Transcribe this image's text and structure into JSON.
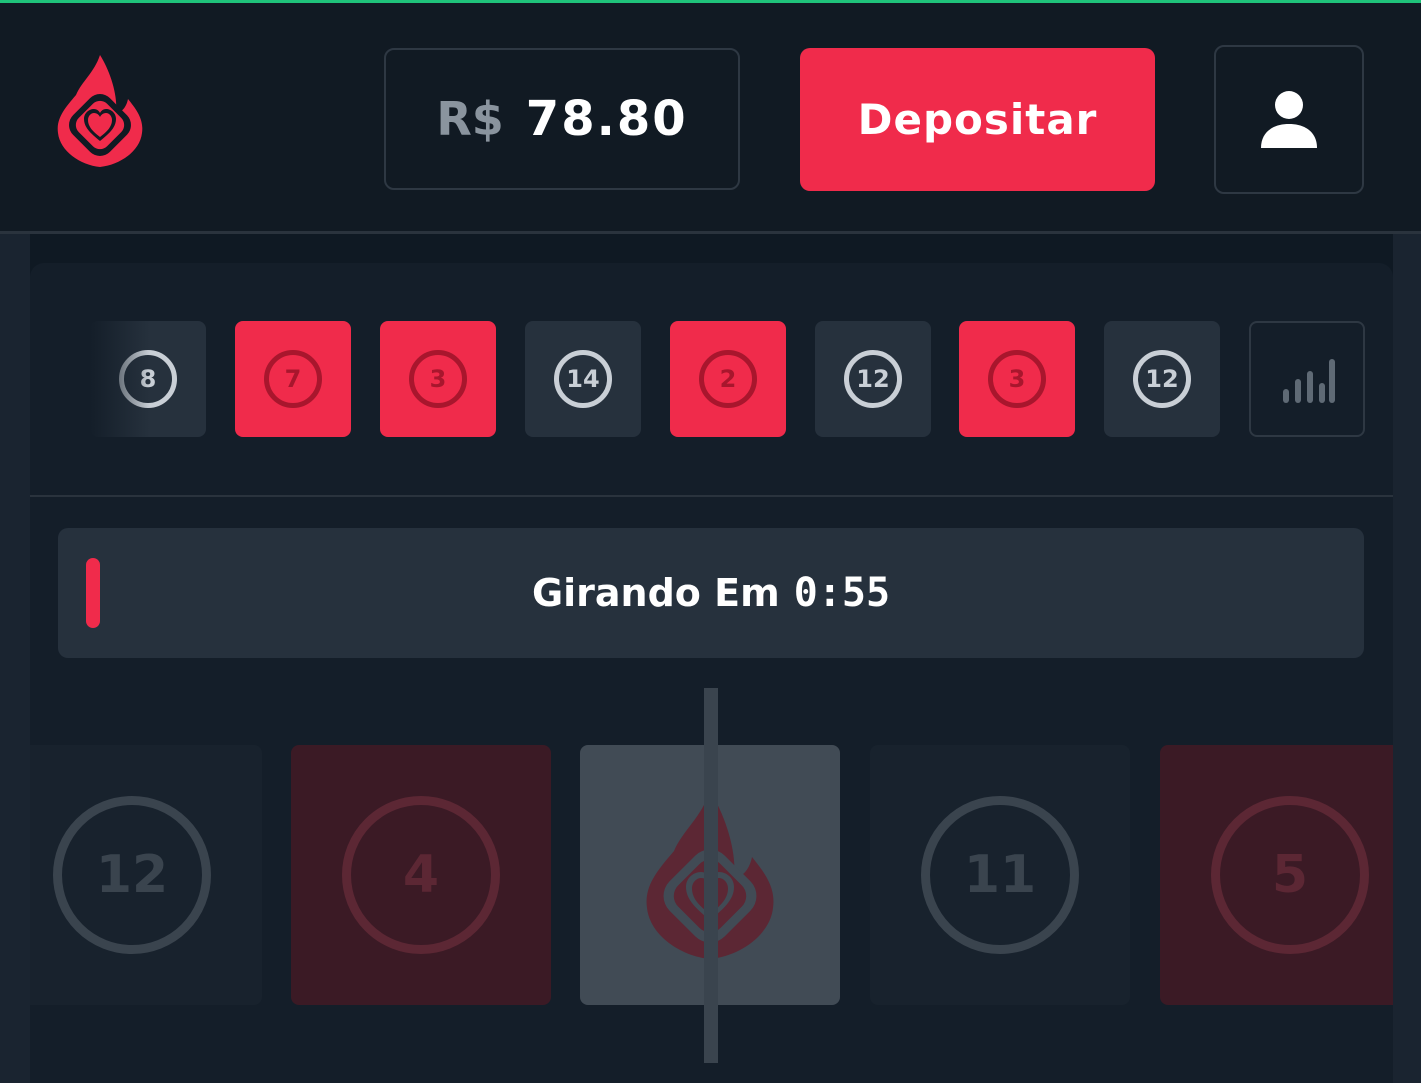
{
  "header": {
    "balance_currency": "R$",
    "balance_amount": "78.80",
    "deposit_label": "Depositar"
  },
  "colors": {
    "accent_red": "#f02b4b",
    "background": "#0f1923",
    "tile_gray": "#26313d"
  },
  "history": {
    "items": [
      {
        "number": "8",
        "color": "gray"
      },
      {
        "number": "7",
        "color": "red"
      },
      {
        "number": "3",
        "color": "red"
      },
      {
        "number": "14",
        "color": "gray"
      },
      {
        "number": "2",
        "color": "red"
      },
      {
        "number": "12",
        "color": "gray"
      },
      {
        "number": "3",
        "color": "red"
      },
      {
        "number": "12",
        "color": "gray"
      }
    ],
    "stats_icon": "bar-chart-icon"
  },
  "timer": {
    "label": "Girando Em",
    "time": "0:55"
  },
  "wheel": {
    "tiles": [
      {
        "number": "12",
        "color": "dark"
      },
      {
        "number": "4",
        "color": "red"
      },
      {
        "number": "",
        "color": "center",
        "icon": "flame-heart-logo"
      },
      {
        "number": "11",
        "color": "dark"
      },
      {
        "number": "5",
        "color": "red"
      }
    ]
  }
}
